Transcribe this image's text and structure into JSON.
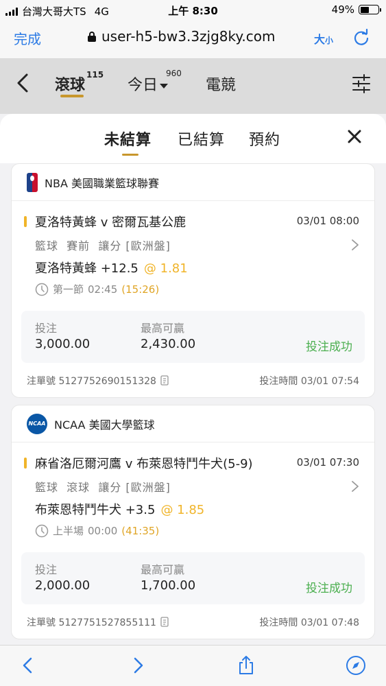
{
  "status_bar": {
    "carrier": "台灣大哥大TS",
    "network": "4G",
    "time": "上午 8:30",
    "battery": "49%",
    "battery_level": 0.49
  },
  "browser": {
    "done_label": "完成",
    "url": "user-h5-bw3.3zjg8ky.com",
    "text_size_big": "大",
    "text_size_small": "小"
  },
  "top_nav": {
    "tabs": [
      {
        "label": "滾球",
        "badge": "115"
      },
      {
        "label": "今日",
        "badge": "960"
      },
      {
        "label": "電競"
      }
    ]
  },
  "sheet": {
    "tabs": [
      {
        "label": "未結算"
      },
      {
        "label": "已結算"
      },
      {
        "label": "預約"
      }
    ]
  },
  "bets": [
    {
      "league": "NBA 美國職業籃球聯賽",
      "league_logo": "nba-logo",
      "match": "夏洛特黃蜂 v 密爾瓦基公鹿",
      "match_time": "03/01 08:00",
      "bet_type": "籃球  賽前  讓分 [歐洲盤]",
      "selection": "夏洛特黃蜂 +12.5",
      "odds": "@ 1.81",
      "period": "第一節",
      "period_clock": "02:45",
      "elapsed": "(15:26)",
      "stake_label": "投注",
      "stake": "3,000.00",
      "max_win_label": "最高可贏",
      "max_win": "2,430.00",
      "status": "投注成功",
      "order_no": "注單號 5127752690151328",
      "bet_time": "投注時間 03/01 07:54"
    },
    {
      "league": "NCAA 美國大學籃球",
      "league_logo": "ncaa-logo",
      "logo_text": "NCAA",
      "match": "麻省洛厄爾河鷹 v 布萊恩特鬥牛犬(5-9)",
      "match_time": "03/01 07:30",
      "bet_type": "籃球  滾球  讓分 [歐洲盤]",
      "selection": "布萊恩特鬥牛犬 +3.5",
      "odds": "@ 1.85",
      "period": "上半場",
      "period_clock": "00:00",
      "elapsed": "(41:35)",
      "stake_label": "投注",
      "stake": "2,000.00",
      "max_win_label": "最高可贏",
      "max_win": "1,700.00",
      "status": "投注成功",
      "order_no": "注單號 5127751527855111",
      "bet_time": "投注時間 03/01 07:48"
    }
  ],
  "colors": {
    "accent": "#c8972d",
    "odds": "#f0b429",
    "success": "#4caf50",
    "link": "#2c7be5"
  }
}
